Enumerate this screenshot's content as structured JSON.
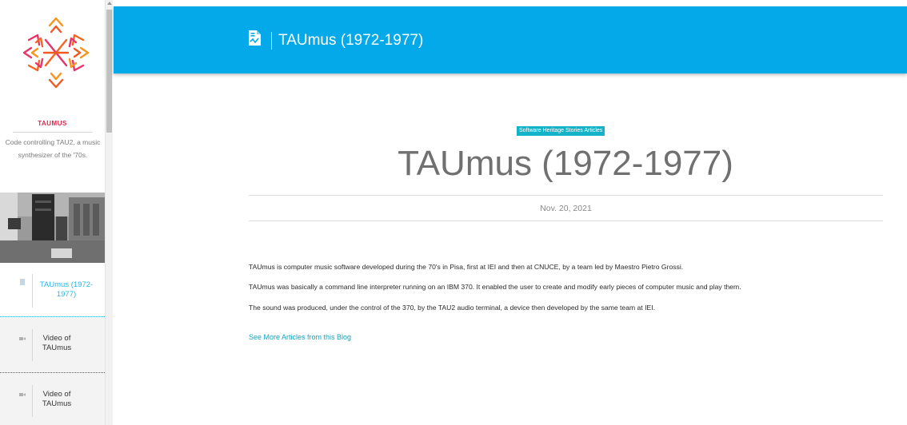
{
  "header": {
    "title": "TAUmus (1972-1977)",
    "icon": "document-icon",
    "background": "#03a9e8"
  },
  "sidebar": {
    "project_name": "TAUMUS",
    "project_description": "Code controlling TAU2, a music synthesizer of the '70s.",
    "items": [
      {
        "label": "TAUmus (1972-1977)",
        "icon": "document-icon",
        "active": true
      },
      {
        "label": "Video of TAUmus",
        "icon": "video-icon",
        "active": false
      },
      {
        "label": "Video of TAUmus",
        "icon": "video-icon",
        "active": false
      }
    ]
  },
  "article": {
    "category": "Software Heritage Stories Articles",
    "title": "TAUmus (1972-1977)",
    "date": "Nov. 20, 2021",
    "paragraphs": [
      "TAUmus is computer music software developed during the 70's in Pisa, first at IEI and then at CNUCE, by a team led by Maestro Pietro Grossi.",
      "TAUmus was basically a command line interpreter running on an IBM 370. It enabled the user to create and modify early pieces of computer music and play them.",
      "The sound was produced, under the control of the 370, by the TAU2 audio terminal, a device then developed by the same team at IEI."
    ],
    "more_link": "See More Articles from this Blog"
  },
  "colors": {
    "accent": "#03a9e8",
    "link": "#14a3c0",
    "project_name": "#e0264a",
    "badge": "#12b3c9"
  }
}
